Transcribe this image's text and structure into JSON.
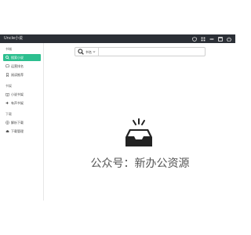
{
  "app": {
    "title": "Uncle小说"
  },
  "window_controls": [
    "shield-icon",
    "grid-icon",
    "minimize-icon",
    "maximize-icon",
    "power-icon"
  ],
  "sidebar": {
    "groups": [
      {
        "title": "书城",
        "items": [
          {
            "label": "搜索小说",
            "icon": "search-icon",
            "active": true
          },
          {
            "label": "运营排名",
            "icon": "chat-icon",
            "active": false
          },
          {
            "label": "阅读推荐",
            "icon": "bookmark-icon",
            "active": false
          }
        ]
      },
      {
        "title": "书架",
        "items": [
          {
            "label": "小说书架",
            "icon": "book-icon",
            "active": false
          },
          {
            "label": "有声书架",
            "icon": "audio-icon",
            "active": false
          }
        ]
      },
      {
        "title": "下载",
        "items": [
          {
            "label": "解析下载",
            "icon": "download-circle-icon",
            "active": false
          },
          {
            "label": "下载管理",
            "icon": "cloud-icon",
            "active": false
          }
        ]
      }
    ]
  },
  "search": {
    "source": "书名",
    "value": "",
    "placeholder": ""
  },
  "empty_state": {
    "icon": "empty-tray-icon"
  },
  "watermark": "公众号：新办公资源",
  "colors": {
    "titlebar": "#2b2f36",
    "accent": "#2dbf8f"
  }
}
